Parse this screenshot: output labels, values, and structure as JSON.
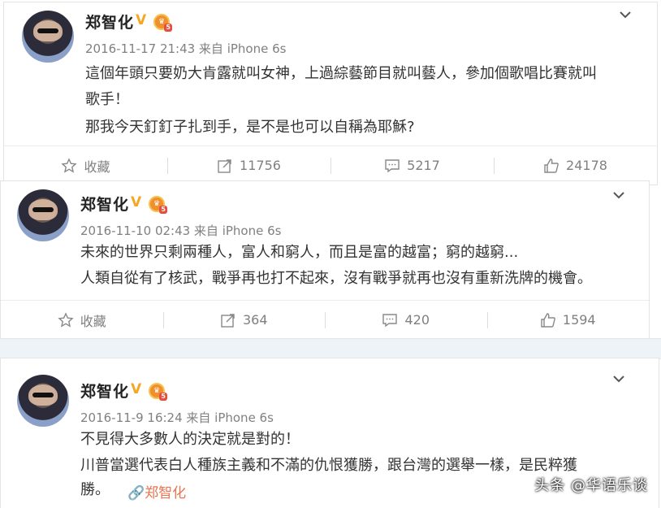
{
  "colors": {
    "accent": "#eb7350",
    "verified": "#f5a623",
    "meta": "#808080"
  },
  "posts": [
    {
      "user": "郑智化",
      "meta": "2016-11-17 21:43 来自 iPhone 6s",
      "lines": [
        "這個年頭只要奶大肯露就叫女神，上過綜藝節目就叫藝人，參加個歌唱比賽就叫",
        "歌手！",
        "那我今天釘釘子扎到手，是不是也可以自稱為耶穌?"
      ],
      "actions": {
        "favorite": "收藏",
        "repost": "11756",
        "comment": "5217",
        "like": "24178"
      }
    },
    {
      "user": "郑智化",
      "meta": "2016-11-10 02:43 来自 iPhone 6s",
      "lines": [
        "未來的世界只剩兩種人，富人和窮人，而且是富的越富；窮的越窮...",
        "人類自從有了核武，戰爭再也打不起來，沒有戰爭就再也沒有重新洗牌的機會。"
      ],
      "actions": {
        "favorite": "收藏",
        "repost": "364",
        "comment": "420",
        "like": "1594"
      }
    },
    {
      "user": "郑智化",
      "meta": "2016-11-9 16:24 来自 iPhone 6s",
      "lines": [
        "不見得大多數人的決定就是對的！",
        "川普當選代表白人種族主義和不滿的仇恨獲勝，跟台灣的選舉一樣，是民粹獲",
        "勝。"
      ],
      "mention": "郑智化"
    }
  ],
  "watermark": "头条 @华语乐谈"
}
